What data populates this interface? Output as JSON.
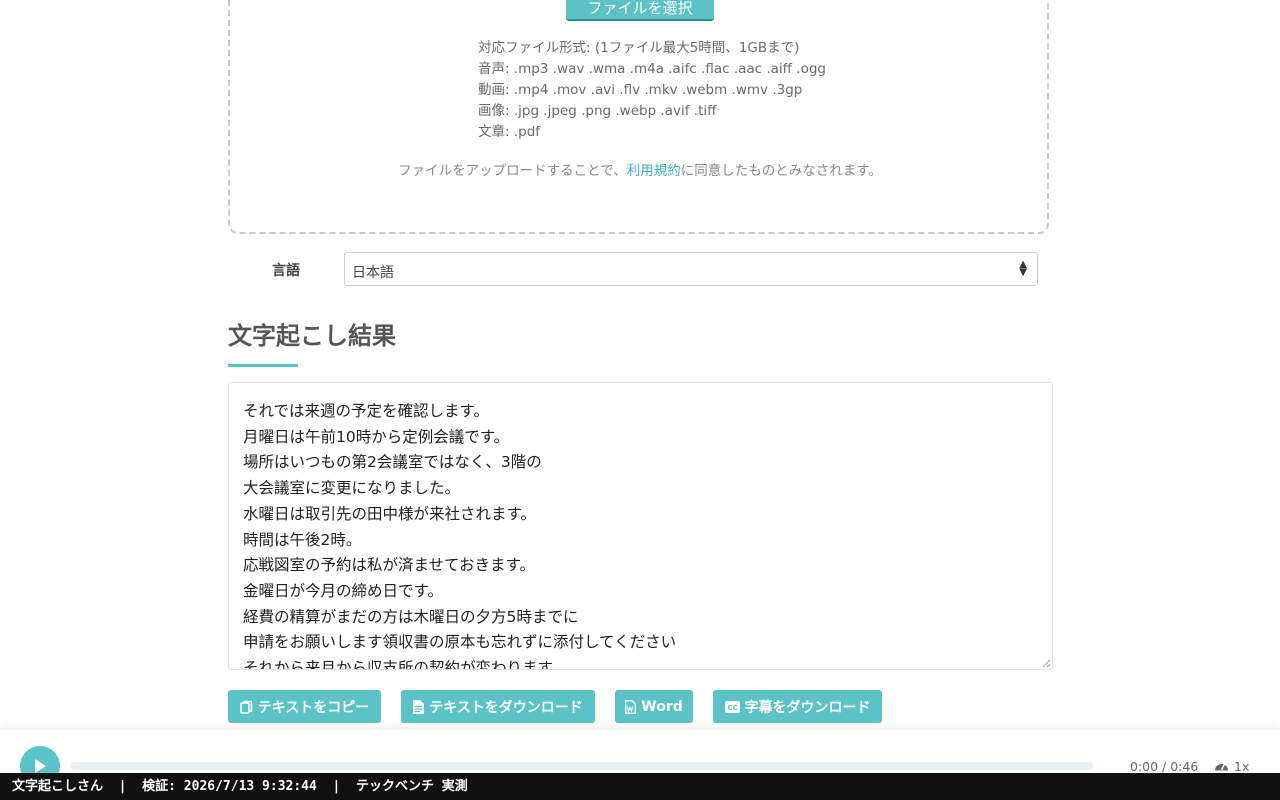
{
  "upload": {
    "choose_button": "ファイルを選択",
    "formats": [
      "対応ファイル形式: (1ファイル最大5時間、1GBまで)",
      "音声: .mp3 .wav .wma .m4a .aifc .flac .aac .aiff .ogg",
      "動画: .mp4 .mov .avi .flv .mkv .webm .wmv .3gp",
      "画像: .jpg .jpeg .png .webp .avif .tiff",
      "文章: .pdf"
    ],
    "terms_prefix": "ファイルをアップロードすることで、",
    "terms_link": "利用規約",
    "terms_suffix": "に同意したものとみなされます。"
  },
  "language": {
    "label": "言語",
    "selected": "日本語"
  },
  "result": {
    "title": "文字起こし結果",
    "lines": [
      "それでは来週の予定を確認します。",
      "月曜日は午前10時から定例会議です。",
      "場所はいつもの第2会議室ではなく、3階の",
      "大会議室に変更になりました。",
      "水曜日は取引先の田中様が来社されます。",
      "時間は午後2時。",
      "応戦図室の予約は私が済ませておきます。",
      "金曜日が今月の締め日です。",
      "経費の精算がまだの方は木曜日の夕方5時までに",
      "申請をお願いします領収書の原本も忘れずに添付してください",
      "それから来月から収支所の契約が変わります"
    ]
  },
  "actions": {
    "copy": "テキストをコピー",
    "download_text": "テキストをダウンロード",
    "word": "Word",
    "download_subtitles": "字幕をダウンロード"
  },
  "player": {
    "time": "0:00 / 0:46",
    "speed": "1x",
    "progress": 0
  },
  "status_bar": {
    "text": "文字起こしさん  |  検証: 2026/7/13 9:32:44  |  テックベンチ 実測"
  },
  "colors": {
    "accent": "#5bc3c6",
    "link": "#3fb6ba",
    "status_bar_bg": "#111111"
  },
  "icons": [
    "play-icon",
    "copy-icon",
    "file-text-icon",
    "word-file-icon",
    "closed-caption-icon",
    "speedometer-icon",
    "select-arrows-icon"
  ]
}
